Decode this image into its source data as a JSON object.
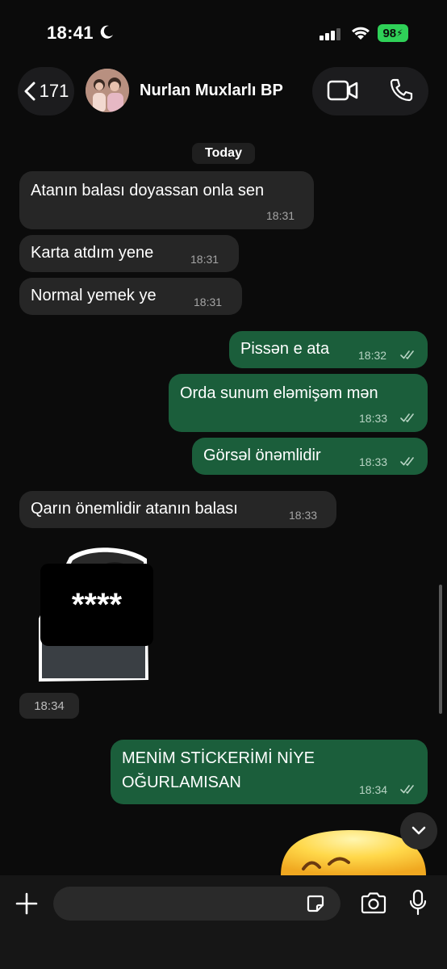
{
  "status_bar": {
    "time": "18:41",
    "battery": "98"
  },
  "header": {
    "back_count": "171",
    "contact_name": "Nurlan Muxlarlı BP"
  },
  "date_chip": "Today",
  "messages": [
    {
      "text": "Atanın balası doyassan onla sen",
      "time": "18:31",
      "direction": "incoming"
    },
    {
      "text": "Karta atdım yene",
      "time": "18:31",
      "direction": "incoming"
    },
    {
      "text": "Normal yemek ye",
      "time": "18:31",
      "direction": "incoming"
    },
    {
      "text": "Pissən e ata",
      "time": "18:32",
      "direction": "outgoing"
    },
    {
      "text": "Orda sunum eləmişəm mən",
      "time": "18:33",
      "direction": "outgoing"
    },
    {
      "text": "Görsəl önəmlidir",
      "time": "18:33",
      "direction": "outgoing"
    },
    {
      "text": "Qarın önemlidir atanın balası",
      "time": "18:33",
      "direction": "incoming"
    },
    {
      "text_line1": "MENİM STİCKERİMİ NİYE",
      "text_line2": "OĞURLAMISAN",
      "time": "18:34",
      "direction": "outgoing"
    }
  ],
  "sticker": {
    "censor_text": "****",
    "time": "18:34"
  },
  "colors": {
    "incoming_bubble": "#262626",
    "outgoing_bubble": "#1b5e3b",
    "battery": "#2fd158",
    "background": "#0b0b0b"
  },
  "icons": [
    "moon-icon",
    "signal-icon",
    "wifi-icon",
    "battery-icon",
    "chevron-left-icon",
    "video-icon",
    "phone-icon",
    "double-check-icon",
    "chevron-down-icon",
    "plus-icon",
    "sticker-icon",
    "camera-icon",
    "mic-icon"
  ]
}
